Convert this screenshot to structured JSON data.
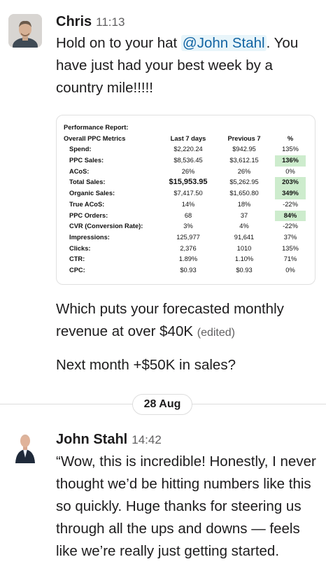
{
  "messages": [
    {
      "sender": "Chris",
      "time": "11:13",
      "text_before_mention": "Hold on to your hat ",
      "mention": "@John Stahl",
      "text_after_mention": ". You have just had your best week by a country mile!!!!!",
      "followup_1": "Which puts your forecasted monthly revenue at over $40K",
      "edited_label": "(edited)",
      "followup_2": "Next month +$50K in sales?"
    },
    {
      "sender": "John Stahl",
      "time": "14:42",
      "text": "“Wow, this is incredible! Honestly, I never thought we’d be hitting numbers like this so quickly. Huge thanks for steering us through all the ups and downs — feels like we’re really just getting started."
    }
  ],
  "date_divider": "28 Aug",
  "report": {
    "title": "Performance Report:",
    "section": "Overall PPC Metrics",
    "columns": [
      "Last 7 days",
      "Previous 7",
      "%"
    ],
    "rows": [
      {
        "label": "Spend:",
        "last7": "$2,220.24",
        "prev7": "$942.95",
        "pct": "135%",
        "highlight": false
      },
      {
        "label": "PPC Sales:",
        "last7": "$8,536.45",
        "prev7": "$3,612.15",
        "pct": "136%",
        "highlight": true
      },
      {
        "label": "ACoS:",
        "last7": "26%",
        "prev7": "26%",
        "pct": "0%",
        "highlight": false
      },
      {
        "label": "Total Sales:",
        "last7": "$15,953.95",
        "prev7": "$5,262.95",
        "pct": "203%",
        "highlight": true
      },
      {
        "label": "Organic Sales:",
        "last7": "$7,417.50",
        "prev7": "$1,650.80",
        "pct": "349%",
        "highlight": true
      },
      {
        "label": "True ACoS:",
        "last7": "14%",
        "prev7": "18%",
        "pct": "-22%",
        "highlight": false
      },
      {
        "label": "PPC Orders:",
        "last7": "68",
        "prev7": "37",
        "pct": "84%",
        "highlight": true
      },
      {
        "label": "CVR (Conversion Rate):",
        "last7": "3%",
        "prev7": "4%",
        "pct": "-22%",
        "highlight": false
      },
      {
        "label": "Impressions:",
        "last7": "125,977",
        "prev7": "91,641",
        "pct": "37%",
        "highlight": false
      },
      {
        "label": "Clicks:",
        "last7": "2,376",
        "prev7": "1010",
        "pct": "135%",
        "highlight": false
      },
      {
        "label": "CTR:",
        "last7": "1.89%",
        "prev7": "1.10%",
        "pct": "71%",
        "highlight": false
      },
      {
        "label": "CPC:",
        "last7": "$0.93",
        "prev7": "$0.93",
        "pct": "0%",
        "highlight": false
      }
    ]
  },
  "colors": {
    "mention_bg": "#e8f5fa",
    "mention_text": "#1264a3",
    "highlight_cell": "#cdeccd",
    "muted_text": "#616061"
  }
}
